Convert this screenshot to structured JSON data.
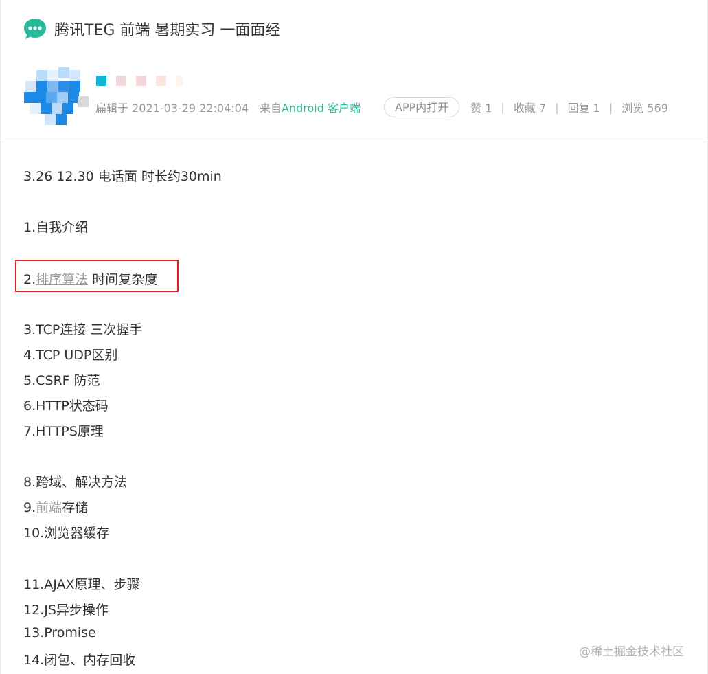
{
  "post": {
    "title": "腾讯TEG 前端 暑期实习 一面面经",
    "edited_label": "扁辑于 2021-03-29 22:04:04",
    "source_prefix": "来自",
    "source_client": "Android 客户端",
    "app_open_label": "APP内打开",
    "stats": {
      "likes": "赞 1",
      "favorites": "收藏 7",
      "replies": "回复 1",
      "views": "浏览 569",
      "separator": "|"
    }
  },
  "colors": {
    "accent_green": "#25bb9b",
    "highlight_red": "#e02020",
    "avatar_blue": "#1e88e5"
  },
  "icons": {
    "title_icon": "chat-bubble-icon"
  },
  "content": {
    "intro": "3.26  12.30  电话面  时长约30min",
    "q1": "1.自我介绍",
    "q2_prefix": "2.",
    "q2_link": "排序算法",
    "q2_suffix": " 时间复杂度",
    "q3": "3.TCP连接 三次握手",
    "q4": "4.TCP UDP区别",
    "q5": "5.CSRF 防范",
    "q6": "6.HTTP状态码",
    "q7": "7.HTTPS原理",
    "q8": "8.跨域、解决方法",
    "q9_prefix": "9.",
    "q9_link": "前端",
    "q9_suffix": "存储",
    "q10": "10.浏览器缓存",
    "q11": "11.AJAX原理、步骤",
    "q12": "12.JS异步操作",
    "q13": "13.Promise",
    "q14": "14.闭包、内存回收"
  },
  "watermark": "@稀土掘金技术社区"
}
